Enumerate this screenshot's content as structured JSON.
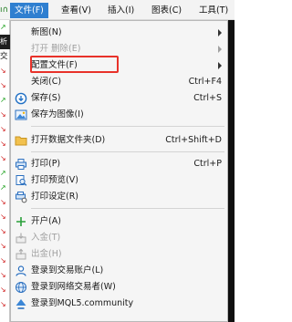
{
  "menubar": {
    "app_glyph": "ı∩",
    "items": [
      {
        "label": "文件(F)",
        "active": true
      },
      {
        "label": "查看(V)",
        "active": false
      },
      {
        "label": "插入(I)",
        "active": false
      },
      {
        "label": "图表(C)",
        "active": false
      },
      {
        "label": "工具(T)",
        "active": false
      }
    ]
  },
  "left_strip": [
    {
      "glyph": "↗",
      "kind": "up"
    },
    {
      "glyph": "析",
      "kind": "blk"
    },
    {
      "glyph": "交",
      "kind": "txt"
    },
    {
      "glyph": "↘",
      "kind": "dn"
    },
    {
      "glyph": "↘",
      "kind": "dn"
    },
    {
      "glyph": "↗",
      "kind": "up"
    },
    {
      "glyph": "↘",
      "kind": "dn"
    },
    {
      "glyph": "↘",
      "kind": "dn"
    },
    {
      "glyph": "↘",
      "kind": "dn"
    },
    {
      "glyph": "↘",
      "kind": "dn"
    },
    {
      "glyph": "↗",
      "kind": "up"
    },
    {
      "glyph": "↗",
      "kind": "up"
    },
    {
      "glyph": "↘",
      "kind": "dn"
    },
    {
      "glyph": "↘",
      "kind": "dn"
    },
    {
      "glyph": "↘",
      "kind": "dn"
    },
    {
      "glyph": "↘",
      "kind": "dn"
    },
    {
      "glyph": "↘",
      "kind": "dn"
    },
    {
      "glyph": "↘",
      "kind": "dn"
    },
    {
      "glyph": "↘",
      "kind": "dn"
    },
    {
      "glyph": "↘",
      "kind": "dn"
    }
  ],
  "file_menu": {
    "new_chart": {
      "label": "新图(N)",
      "icon": "none",
      "submenu": true
    },
    "open_deleted": {
      "label": "打开 删除(E)",
      "icon": "none",
      "submenu": true,
      "disabled": true
    },
    "profiles": {
      "label": "配置文件(F)",
      "icon": "none",
      "submenu": true,
      "highlighted": true
    },
    "close": {
      "label": "关闭(C)",
      "shortcut": "Ctrl+F4",
      "icon": "none"
    },
    "save": {
      "label": "保存(S)",
      "shortcut": "Ctrl+S",
      "icon": "save-icon"
    },
    "save_as_picture": {
      "label": "保存为图像(I)",
      "icon": "picture-icon"
    },
    "open_data_folder": {
      "label": "打开数据文件夹(D)",
      "shortcut": "Ctrl+Shift+D",
      "icon": "folder-icon"
    },
    "print": {
      "label": "打印(P)",
      "shortcut": "Ctrl+P",
      "icon": "print-icon"
    },
    "print_preview": {
      "label": "打印预览(V)",
      "icon": "print-preview-icon"
    },
    "print_setup": {
      "label": "打印设定(R)",
      "icon": "print-setup-icon"
    },
    "open_account": {
      "label": "开户(A)",
      "icon": "plus-icon"
    },
    "deposit": {
      "label": "入金(T)",
      "icon": "deposit-icon",
      "disabled": true
    },
    "withdraw": {
      "label": "出金(H)",
      "icon": "withdraw-icon",
      "disabled": true
    },
    "login_trade": {
      "label": "登录到交易账户(L)",
      "icon": "user-icon"
    },
    "login_web": {
      "label": "登录到网络交易者(W)",
      "icon": "globe-icon"
    },
    "login_mql5": {
      "label": "登录到MQL5.community",
      "icon": "mql5-icon"
    }
  },
  "colors": {
    "accent": "#2f7fd0",
    "highlight_border": "#e8322a",
    "menu_bg": "#f5f5f5",
    "disabled_text": "#a0a0a0"
  }
}
